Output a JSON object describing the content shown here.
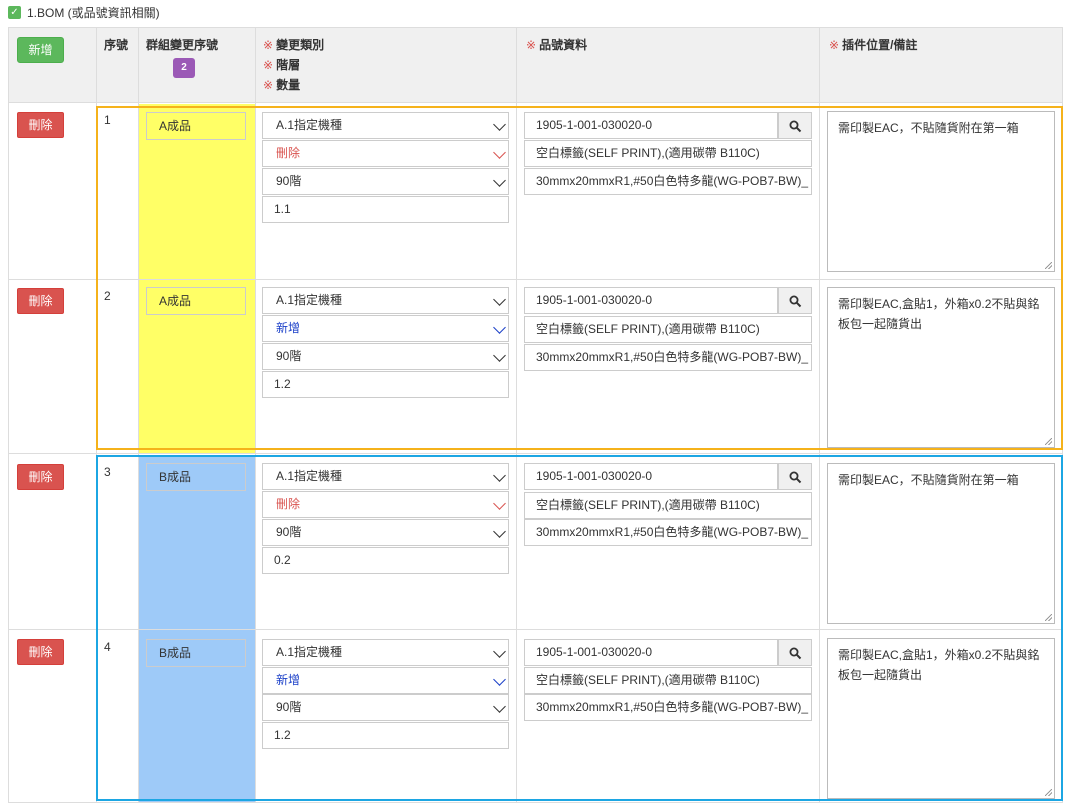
{
  "section": {
    "title": "1.BOM (或品號資訊相關)"
  },
  "header": {
    "add_button": "新增",
    "col_seq": "序號",
    "col_group": "群組變更序號",
    "group_badge": "2",
    "req_mark": "※",
    "col_change_type": "變更類別",
    "col_level": "階層",
    "col_qty": "數量",
    "col_part": "品號資料",
    "col_position": "插件位置/備註"
  },
  "rows": [
    {
      "delete": "刪除",
      "seq": "1",
      "group": "A成品",
      "change_type": "A.1指定機種",
      "action": "刪除",
      "level": "90階",
      "qty": "1.1",
      "part_no": "1905-1-001-030020-0",
      "part_name": "空白標籤(SELF PRINT),(適用碳帶 B110C)",
      "part_spec": "30mmx20mmxR1,#50白色特多龍(WG-POB7-BW)_",
      "note": "需印製EAC，不貼隨貨附在第一箱"
    },
    {
      "delete": "刪除",
      "seq": "2",
      "group": "A成品",
      "change_type": "A.1指定機種",
      "action": "新增",
      "level": "90階",
      "qty": "1.2",
      "part_no": "1905-1-001-030020-0",
      "part_name": "空白標籤(SELF PRINT),(適用碳帶 B110C)",
      "part_spec": "30mmx20mmxR1,#50白色特多龍(WG-POB7-BW)_",
      "note": "需印製EAC,盒貼1，外箱x0.2不貼與銘板包一起隨貨出"
    },
    {
      "delete": "刪除",
      "seq": "3",
      "group": "B成品",
      "change_type": "A.1指定機種",
      "action": "刪除",
      "level": "90階",
      "qty": "0.2",
      "part_no": "1905-1-001-030020-0",
      "part_name": "空白標籤(SELF PRINT),(適用碳帶 B110C)",
      "part_spec": "30mmx20mmxR1,#50白色特多龍(WG-POB7-BW)_",
      "note": "需印製EAC，不貼隨貨附在第一箱"
    },
    {
      "delete": "刪除",
      "seq": "4",
      "group": "B成品",
      "change_type": "A.1指定機種",
      "action": "新增",
      "level": "90階",
      "qty": "1.2",
      "part_no": "1905-1-001-030020-0",
      "part_name": "空白標籤(SELF PRINT),(適用碳帶 B110C)",
      "part_spec": "30mmx20mmxR1,#50白色特多龍(WG-POB7-BW)_",
      "note": "需印製EAC,盒貼1，外箱x0.2不貼與銘板包一起隨貨出"
    }
  ],
  "colors": {
    "group_a": "#ffff66",
    "group_b": "#9ecaf8",
    "highlight_a": "#f5b21b",
    "highlight_b": "#1ca6e3"
  }
}
